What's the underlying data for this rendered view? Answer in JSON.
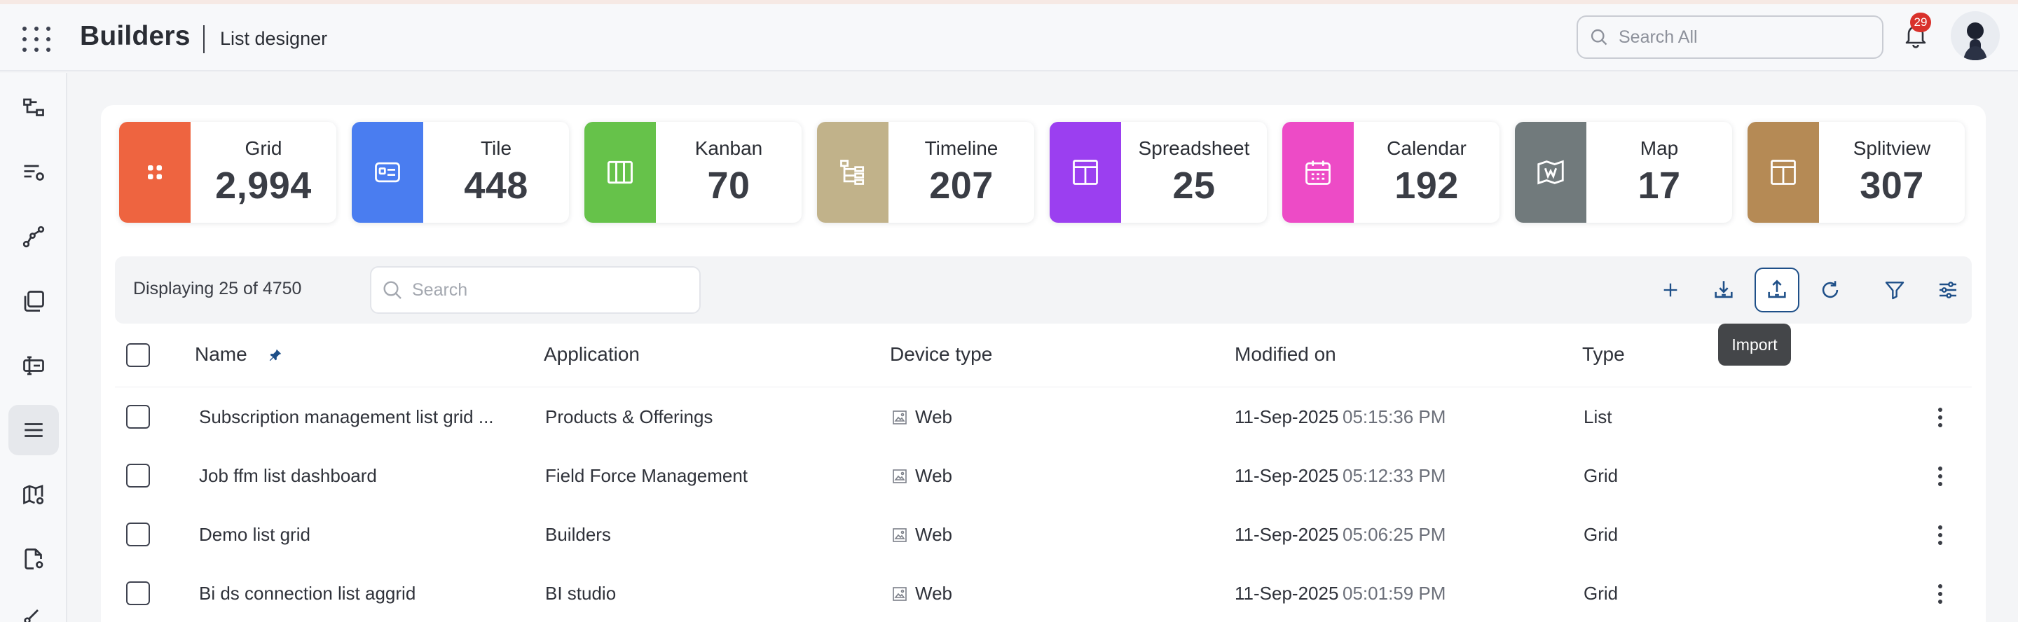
{
  "header": {
    "brand": "Builders",
    "subtitle": "List designer",
    "search_placeholder": "Search All",
    "notification_count": "29"
  },
  "stats": [
    {
      "label": "Grid",
      "value": "2,994",
      "color": "#ee6440",
      "icon": "grid-dots-icon"
    },
    {
      "label": "Tile",
      "value": "448",
      "color": "#4a7df0",
      "icon": "tile-card-icon"
    },
    {
      "label": "Kanban",
      "value": "70",
      "color": "#66c24a",
      "icon": "kanban-columns-icon"
    },
    {
      "label": "Timeline",
      "value": "207",
      "color": "#c1b28a",
      "icon": "timeline-tree-icon"
    },
    {
      "label": "Spreadsheet",
      "value": "25",
      "color": "#9b3ff0",
      "icon": "spreadsheet-icon"
    },
    {
      "label": "Calendar",
      "value": "192",
      "color": "#ed4bc6",
      "icon": "calendar-icon"
    },
    {
      "label": "Map",
      "value": "17",
      "color": "#717a7c",
      "icon": "map-icon"
    },
    {
      "label": "Splitview",
      "value": "307",
      "color": "#b58a55",
      "icon": "splitview-icon"
    }
  ],
  "toolbar": {
    "displaying": "Displaying 25 of 4750",
    "search_placeholder": "Search",
    "tooltip": "Import"
  },
  "columns": [
    "Name",
    "Application",
    "Device type",
    "Modified on",
    "Type"
  ],
  "rows": [
    {
      "name": "Subscription management list grid ...",
      "application": "Products & Offerings",
      "device": "Web",
      "date": "11-Sep-2025",
      "time": "05:15:36 PM",
      "type": "List"
    },
    {
      "name": "Job ffm list dashboard",
      "application": "Field Force Management",
      "device": "Web",
      "date": "11-Sep-2025",
      "time": "05:12:33 PM",
      "type": "Grid"
    },
    {
      "name": "Demo list grid",
      "application": "Builders",
      "device": "Web",
      "date": "11-Sep-2025",
      "time": "05:06:25 PM",
      "type": "Grid"
    },
    {
      "name": "Bi ds connection list aggrid",
      "application": "BI studio",
      "device": "Web",
      "date": "11-Sep-2025",
      "time": "05:01:59 PM",
      "type": "Grid"
    }
  ],
  "accent_color": "#1e4f88"
}
